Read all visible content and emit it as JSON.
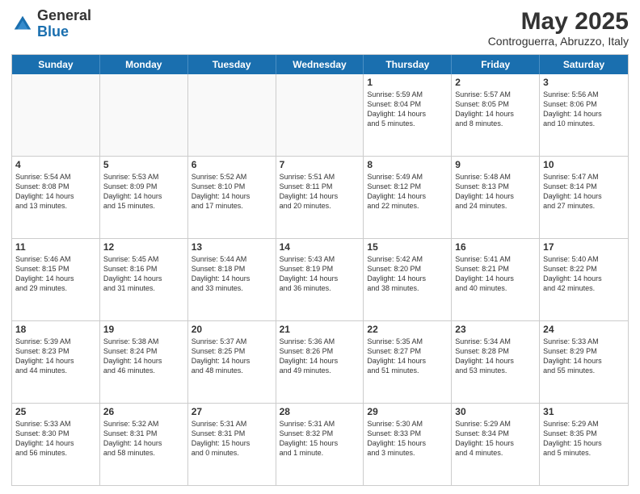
{
  "header": {
    "logo": {
      "general": "General",
      "blue": "Blue"
    },
    "title": "May 2025",
    "location": "Controguerra, Abruzzo, Italy"
  },
  "calendar": {
    "days": [
      "Sunday",
      "Monday",
      "Tuesday",
      "Wednesday",
      "Thursday",
      "Friday",
      "Saturday"
    ],
    "rows": [
      [
        {
          "day": "",
          "info": ""
        },
        {
          "day": "",
          "info": ""
        },
        {
          "day": "",
          "info": ""
        },
        {
          "day": "",
          "info": ""
        },
        {
          "day": "1",
          "info": "Sunrise: 5:59 AM\nSunset: 8:04 PM\nDaylight: 14 hours\nand 5 minutes."
        },
        {
          "day": "2",
          "info": "Sunrise: 5:57 AM\nSunset: 8:05 PM\nDaylight: 14 hours\nand 8 minutes."
        },
        {
          "day": "3",
          "info": "Sunrise: 5:56 AM\nSunset: 8:06 PM\nDaylight: 14 hours\nand 10 minutes."
        }
      ],
      [
        {
          "day": "4",
          "info": "Sunrise: 5:54 AM\nSunset: 8:08 PM\nDaylight: 14 hours\nand 13 minutes."
        },
        {
          "day": "5",
          "info": "Sunrise: 5:53 AM\nSunset: 8:09 PM\nDaylight: 14 hours\nand 15 minutes."
        },
        {
          "day": "6",
          "info": "Sunrise: 5:52 AM\nSunset: 8:10 PM\nDaylight: 14 hours\nand 17 minutes."
        },
        {
          "day": "7",
          "info": "Sunrise: 5:51 AM\nSunset: 8:11 PM\nDaylight: 14 hours\nand 20 minutes."
        },
        {
          "day": "8",
          "info": "Sunrise: 5:49 AM\nSunset: 8:12 PM\nDaylight: 14 hours\nand 22 minutes."
        },
        {
          "day": "9",
          "info": "Sunrise: 5:48 AM\nSunset: 8:13 PM\nDaylight: 14 hours\nand 24 minutes."
        },
        {
          "day": "10",
          "info": "Sunrise: 5:47 AM\nSunset: 8:14 PM\nDaylight: 14 hours\nand 27 minutes."
        }
      ],
      [
        {
          "day": "11",
          "info": "Sunrise: 5:46 AM\nSunset: 8:15 PM\nDaylight: 14 hours\nand 29 minutes."
        },
        {
          "day": "12",
          "info": "Sunrise: 5:45 AM\nSunset: 8:16 PM\nDaylight: 14 hours\nand 31 minutes."
        },
        {
          "day": "13",
          "info": "Sunrise: 5:44 AM\nSunset: 8:18 PM\nDaylight: 14 hours\nand 33 minutes."
        },
        {
          "day": "14",
          "info": "Sunrise: 5:43 AM\nSunset: 8:19 PM\nDaylight: 14 hours\nand 36 minutes."
        },
        {
          "day": "15",
          "info": "Sunrise: 5:42 AM\nSunset: 8:20 PM\nDaylight: 14 hours\nand 38 minutes."
        },
        {
          "day": "16",
          "info": "Sunrise: 5:41 AM\nSunset: 8:21 PM\nDaylight: 14 hours\nand 40 minutes."
        },
        {
          "day": "17",
          "info": "Sunrise: 5:40 AM\nSunset: 8:22 PM\nDaylight: 14 hours\nand 42 minutes."
        }
      ],
      [
        {
          "day": "18",
          "info": "Sunrise: 5:39 AM\nSunset: 8:23 PM\nDaylight: 14 hours\nand 44 minutes."
        },
        {
          "day": "19",
          "info": "Sunrise: 5:38 AM\nSunset: 8:24 PM\nDaylight: 14 hours\nand 46 minutes."
        },
        {
          "day": "20",
          "info": "Sunrise: 5:37 AM\nSunset: 8:25 PM\nDaylight: 14 hours\nand 48 minutes."
        },
        {
          "day": "21",
          "info": "Sunrise: 5:36 AM\nSunset: 8:26 PM\nDaylight: 14 hours\nand 49 minutes."
        },
        {
          "day": "22",
          "info": "Sunrise: 5:35 AM\nSunset: 8:27 PM\nDaylight: 14 hours\nand 51 minutes."
        },
        {
          "day": "23",
          "info": "Sunrise: 5:34 AM\nSunset: 8:28 PM\nDaylight: 14 hours\nand 53 minutes."
        },
        {
          "day": "24",
          "info": "Sunrise: 5:33 AM\nSunset: 8:29 PM\nDaylight: 14 hours\nand 55 minutes."
        }
      ],
      [
        {
          "day": "25",
          "info": "Sunrise: 5:33 AM\nSunset: 8:30 PM\nDaylight: 14 hours\nand 56 minutes."
        },
        {
          "day": "26",
          "info": "Sunrise: 5:32 AM\nSunset: 8:31 PM\nDaylight: 14 hours\nand 58 minutes."
        },
        {
          "day": "27",
          "info": "Sunrise: 5:31 AM\nSunset: 8:31 PM\nDaylight: 15 hours\nand 0 minutes."
        },
        {
          "day": "28",
          "info": "Sunrise: 5:31 AM\nSunset: 8:32 PM\nDaylight: 15 hours\nand 1 minute."
        },
        {
          "day": "29",
          "info": "Sunrise: 5:30 AM\nSunset: 8:33 PM\nDaylight: 15 hours\nand 3 minutes."
        },
        {
          "day": "30",
          "info": "Sunrise: 5:29 AM\nSunset: 8:34 PM\nDaylight: 15 hours\nand 4 minutes."
        },
        {
          "day": "31",
          "info": "Sunrise: 5:29 AM\nSunset: 8:35 PM\nDaylight: 15 hours\nand 5 minutes."
        }
      ]
    ]
  }
}
